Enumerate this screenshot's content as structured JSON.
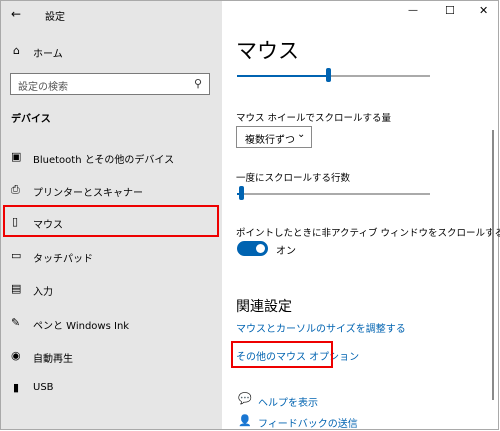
{
  "window": {
    "title": "設定",
    "back_glyph": "←",
    "minimize_glyph": "—",
    "maximize_glyph": "☐",
    "close_glyph": "✕"
  },
  "sidebar": {
    "home_label": "ホーム",
    "search_placeholder": "設定の検索",
    "section_title": "デバイス",
    "items": [
      {
        "label": "Bluetooth とその他のデバイス",
        "icon": "bluetooth-devices-icon",
        "glyph": "▣"
      },
      {
        "label": "プリンターとスキャナー",
        "icon": "printer-icon",
        "glyph": "⎙"
      },
      {
        "label": "マウス",
        "icon": "mouse-icon",
        "glyph": "▯"
      },
      {
        "label": "タッチパッド",
        "icon": "touchpad-icon",
        "glyph": "▭"
      },
      {
        "label": "入力",
        "icon": "keyboard-icon",
        "glyph": "▤"
      },
      {
        "label": "ペンと Windows Ink",
        "icon": "pen-icon",
        "glyph": "✎"
      },
      {
        "label": "自動再生",
        "icon": "autoplay-icon",
        "glyph": "◉"
      },
      {
        "label": "USB",
        "icon": "usb-icon",
        "glyph": "▮"
      }
    ],
    "selected_item": "マウス"
  },
  "main": {
    "page_title": "マウス",
    "cursor_speed_level": 0.47,
    "wheel_scroll_label": "マウス ホイールでスクロールする量",
    "wheel_scroll_value": "複数行ずつ",
    "lines_label": "一度にスクロールする行数",
    "lines_level": 0.02,
    "inactive_scroll_label": "ポイントしたときに非アクティブ ウィンドウをスクロールする",
    "toggle_state": "オン",
    "related_title": "関連設定",
    "related_links": [
      "マウスとカーソルのサイズを調整する",
      "その他のマウス オプション"
    ],
    "help_link": "ヘルプを表示",
    "feedback_link": "フィードバックの送信"
  },
  "colors": {
    "accent": "#0063b1",
    "highlight": "#e00000",
    "sidebar_bg": "#e6e6e6"
  }
}
